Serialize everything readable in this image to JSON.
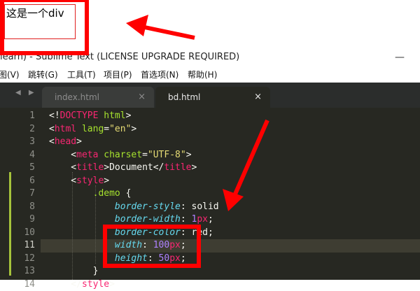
{
  "preview": {
    "div_text": "这是一个div"
  },
  "window": {
    "title": "learn) - Sublime Text (LICENSE UPGRADE REQUIRED)",
    "minimize_glyph": "—"
  },
  "menu": {
    "items": [
      "图(V)",
      "跳转(G)",
      "工具(T)",
      "项目(P)",
      "首选项(N)",
      "帮助(H)"
    ]
  },
  "tabs": [
    {
      "label": "index.html",
      "close": "×"
    },
    {
      "label": "bd.html",
      "close": "×"
    }
  ],
  "nav_arrows": "◀ ▶",
  "editor": {
    "line_numbers": [
      "1",
      "2",
      "3",
      "4",
      "5",
      "6",
      "7",
      "8",
      "9",
      "10",
      "11",
      "12",
      "13",
      "14"
    ],
    "highlighted_line": 11,
    "lines": [
      [
        [
          "w",
          "<!"
        ],
        [
          "t",
          "DOCTYPE"
        ],
        [
          "w",
          " "
        ],
        [
          "a",
          "html"
        ],
        [
          "w",
          ">"
        ]
      ],
      [
        [
          "w",
          "<"
        ],
        [
          "t",
          "html"
        ],
        [
          "w",
          " "
        ],
        [
          "a",
          "lang"
        ],
        [
          "w",
          "="
        ],
        [
          "s",
          "\"en\""
        ],
        [
          "w",
          ">"
        ]
      ],
      [
        [
          "w",
          "<"
        ],
        [
          "t",
          "head"
        ],
        [
          "w",
          ">"
        ]
      ],
      [
        [
          "w",
          "    <"
        ],
        [
          "t",
          "meta"
        ],
        [
          "w",
          " "
        ],
        [
          "a",
          "charset"
        ],
        [
          "w",
          "="
        ],
        [
          "s",
          "\"UTF-8\""
        ],
        [
          "w",
          ">"
        ]
      ],
      [
        [
          "w",
          "    <"
        ],
        [
          "t",
          "title"
        ],
        [
          "w",
          ">Document</"
        ],
        [
          "t",
          "title"
        ],
        [
          "w",
          ">"
        ]
      ],
      [
        [
          "w",
          "    <"
        ],
        [
          "t",
          "style"
        ],
        [
          "w",
          ">"
        ]
      ],
      [
        [
          "w",
          "        "
        ],
        [
          "a",
          ".demo"
        ],
        [
          "w",
          " {"
        ]
      ],
      [
        [
          "w",
          "            "
        ],
        [
          "p",
          "border-style"
        ],
        [
          "w",
          ": "
        ],
        [
          "w",
          "solid"
        ]
      ],
      [
        [
          "w",
          "            "
        ],
        [
          "p",
          "border-width"
        ],
        [
          "w",
          ": "
        ],
        [
          "n",
          "1"
        ],
        [
          "u",
          "px"
        ],
        [
          "w",
          ";"
        ]
      ],
      [
        [
          "w",
          "            "
        ],
        [
          "p",
          "border-color"
        ],
        [
          "w",
          ": red;"
        ]
      ],
      [
        [
          "w",
          "            "
        ],
        [
          "p",
          "width"
        ],
        [
          "w",
          ": "
        ],
        [
          "n",
          "100"
        ],
        [
          "u",
          "px"
        ],
        [
          "w",
          ";"
        ]
      ],
      [
        [
          "w",
          "            "
        ],
        [
          "p",
          "height"
        ],
        [
          "w",
          ": "
        ],
        [
          "n",
          "50"
        ],
        [
          "u",
          "px"
        ],
        [
          "w",
          ";"
        ]
      ],
      [
        [
          "w",
          "        }"
        ]
      ],
      [
        [
          "w",
          "    </"
        ],
        [
          "t",
          "style"
        ],
        [
          "w",
          ">"
        ]
      ]
    ]
  },
  "colors": {
    "annotation_red": "#ff0000",
    "editor_bg": "#272822",
    "tag": "#f92672",
    "attribute": "#a6e22e",
    "string": "#e6db74",
    "property": "#66d9ef",
    "number": "#ae81ff"
  }
}
